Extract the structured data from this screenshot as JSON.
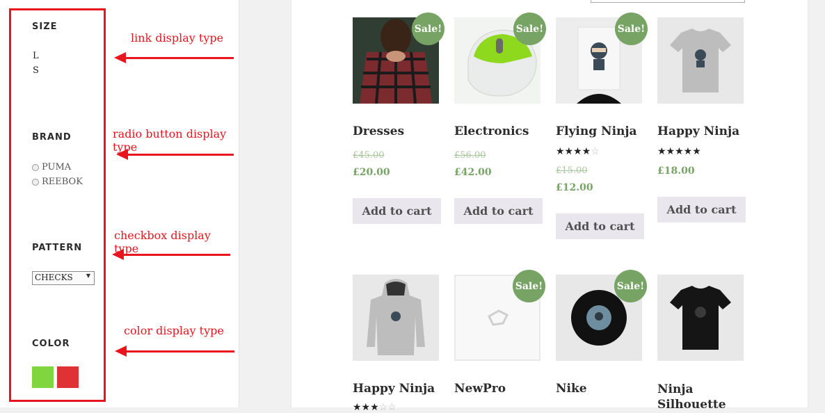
{
  "sidebar": {
    "size": {
      "title": "SIZE",
      "options": [
        "L",
        "S"
      ]
    },
    "brand": {
      "title": "BRAND",
      "options": [
        "PUMA",
        "REEBOK"
      ]
    },
    "pattern": {
      "title": "PATTERN",
      "selected": "CHECKS"
    },
    "color": {
      "title": "COLOR",
      "swatches": [
        "#80d63f",
        "#e03234"
      ]
    }
  },
  "annotations": {
    "link": "link display type",
    "radio": "radio button display type",
    "checkbox": "checkbox display type",
    "color": "color display type"
  },
  "colors": {
    "annotation_red": "#e8141e",
    "sale_green": "#77a464",
    "button_bg": "#e9e6ed"
  },
  "products": [
    {
      "title": "Dresses",
      "old_price": "£45.00",
      "price": "£20.00",
      "sale": "Sale!",
      "button": "Add to cart",
      "icon": "dress-photo"
    },
    {
      "title": "Electronics",
      "old_price": "£56.00",
      "price": "£42.00",
      "sale": "Sale!",
      "button": "Add to cart",
      "icon": "mouse-photo"
    },
    {
      "title": "Flying Ninja",
      "rating": 4,
      "old_price": "£15.00",
      "price": "£12.00",
      "sale": "Sale!",
      "button": "Add to cart",
      "icon": "ninja-poster-photo"
    },
    {
      "title": "Happy Ninja",
      "rating": 5,
      "price": "£18.00",
      "button": "Add to cart",
      "icon": "tshirt-photo"
    },
    {
      "title": "Happy Ninja",
      "rating": 3,
      "icon": "hoodie-photo"
    },
    {
      "title": "NewPro",
      "sale": "Sale!",
      "icon": "placeholder-image"
    },
    {
      "title": "Nike",
      "sale": "Sale!",
      "icon": "vinyl-record-photo"
    },
    {
      "title": "Ninja Silhouette",
      "icon": "black-tshirt-photo"
    }
  ]
}
